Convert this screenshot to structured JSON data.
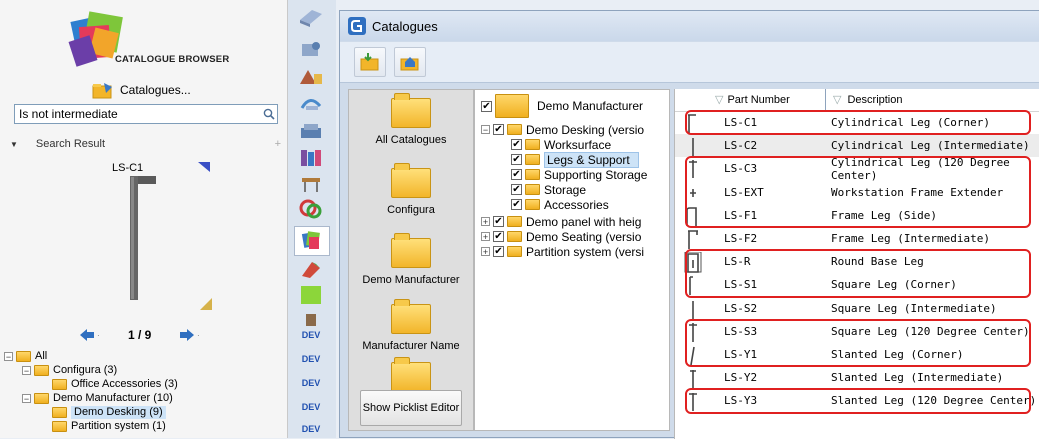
{
  "left_panel": {
    "logo_text": "CATALOGUE BROWSER",
    "catalogues_link": "Catalogues...",
    "search_value": "Is not intermediate",
    "search_result_label": "Search Result",
    "preview_label": "LS-C1",
    "pager": "1 / 9",
    "tree": [
      {
        "label": "All",
        "level": 0,
        "expander": "−"
      },
      {
        "label": "Configura (3)",
        "level": 1,
        "expander": "−"
      },
      {
        "label": "Office Accessories (3)",
        "level": 2,
        "expander": ""
      },
      {
        "label": "Demo Manufacturer (10)",
        "level": 1,
        "expander": "−"
      },
      {
        "label": "Demo Desking (9)",
        "level": 2,
        "expander": "",
        "selected": true
      },
      {
        "label": "Partition system (1)",
        "level": 2,
        "expander": ""
      }
    ]
  },
  "window": {
    "title": "Catalogues",
    "catalog_list": [
      "All Catalogues",
      "Configura",
      "Demo Manufacturer",
      "Manufacturer Name"
    ],
    "picklist_button": "Show Picklist Editor",
    "mid_tree": [
      {
        "label": "Demo Manufacturer",
        "level": 0
      },
      {
        "label": "Demo Desking (versio",
        "level": 1
      },
      {
        "label": "Worksurface",
        "level": 2
      },
      {
        "label": "Legs & Support",
        "level": 2,
        "selected": true
      },
      {
        "label": "Supporting Storage",
        "level": 2
      },
      {
        "label": "Storage",
        "level": 2
      },
      {
        "label": "Accessories",
        "level": 2
      },
      {
        "label": "Demo panel with heig",
        "level": 1
      },
      {
        "label": "Demo Seating (versio",
        "level": 1
      },
      {
        "label": "Partition system (versi",
        "level": 1
      }
    ],
    "grid": {
      "headers": [
        "Part Number",
        "Description"
      ],
      "rows": [
        {
          "part": "LS-C1",
          "desc": "Cylindrical Leg (Corner)"
        },
        {
          "part": "LS-C2",
          "desc": "Cylindrical Leg (Intermediate)"
        },
        {
          "part": "LS-C3",
          "desc": "Cylindrical Leg (120 Degree Center)"
        },
        {
          "part": "LS-EXT",
          "desc": "Workstation Frame Extender"
        },
        {
          "part": "LS-F1",
          "desc": "Frame Leg (Side)"
        },
        {
          "part": "LS-F2",
          "desc": "Frame Leg (Intermediate)"
        },
        {
          "part": "LS-R",
          "desc": "Round Base Leg"
        },
        {
          "part": "LS-S1",
          "desc": "Square Leg (Corner)"
        },
        {
          "part": "LS-S2",
          "desc": "Square Leg (Intermediate)"
        },
        {
          "part": "LS-S3",
          "desc": "Square Leg (120 Degree Center)"
        },
        {
          "part": "LS-Y1",
          "desc": "Slanted Leg (Corner)"
        },
        {
          "part": "LS-Y2",
          "desc": "Slanted Leg (Intermediate)"
        },
        {
          "part": "LS-Y3",
          "desc": "Slanted Leg (120 Degree Center)"
        }
      ]
    }
  },
  "icon_strip": [
    "DEV",
    "DEV",
    "DEV",
    "DEV",
    "DEV"
  ],
  "colors": {
    "highlight": "#e02020",
    "selection": "#cde3f7",
    "accent": "#3a78c5"
  }
}
